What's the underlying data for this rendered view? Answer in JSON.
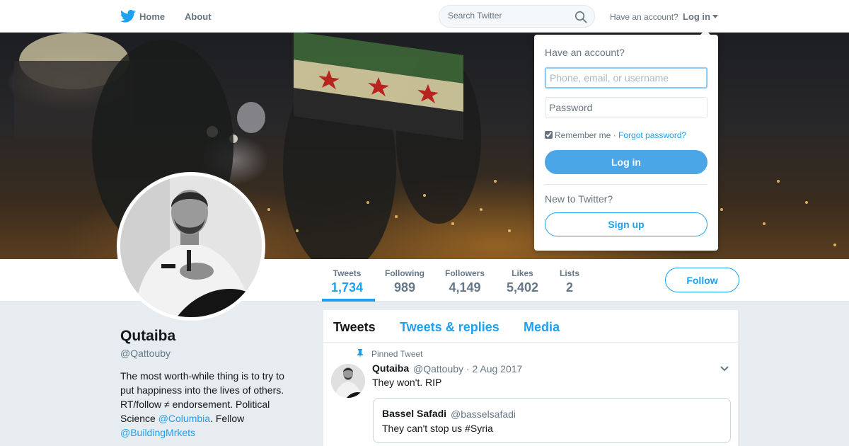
{
  "colors": {
    "brand": "#1da1f2",
    "page_bg": "#e6ecf0",
    "header_bg": "#ffffff"
  },
  "nav": {
    "logo_icon": "twitter-bird-icon",
    "home": "Home",
    "about": "About",
    "search_placeholder": "Search Twitter",
    "search_icon": "search-icon",
    "have_account": "Have an account?",
    "login": "Log in"
  },
  "login_dropdown": {
    "title": "Have an account?",
    "username_placeholder": "Phone, email, or username",
    "password_placeholder": "Password",
    "remember_me": "Remember me",
    "separator": " · ",
    "forgot_password": "Forgot password?",
    "login_button": "Log in",
    "new_to_twitter": "New to Twitter?",
    "signup_button": "Sign up"
  },
  "profile_nav": {
    "stats": [
      {
        "label": "Tweets",
        "value": "1,734"
      },
      {
        "label": "Following",
        "value": "989"
      },
      {
        "label": "Followers",
        "value": "4,149"
      },
      {
        "label": "Likes",
        "value": "5,402"
      },
      {
        "label": "Lists",
        "value": "2"
      }
    ],
    "follow_button": "Follow"
  },
  "profile": {
    "name": "Qutaiba",
    "handle": "@Qattouby",
    "bio_part1": "The most worth-while thing is to try to put happiness into the lives of others. RT/follow ≠ endorsement. Political Science ",
    "bio_link1": "@Columbia",
    "bio_part2": ". Fellow ",
    "bio_link2": "@BuildingMrkets"
  },
  "timeline": {
    "tabs": [
      "Tweets",
      "Tweets & replies",
      "Media"
    ],
    "pinned_label": "Pinned Tweet",
    "tweet": {
      "name": "Qutaiba",
      "meta": "@Qattouby · 2 Aug 2017",
      "text": "They won't. RIP",
      "quote": {
        "name": "Bassel Safadi",
        "handle": "@basselsafadi",
        "text": "They can't stop us #Syria"
      }
    }
  }
}
